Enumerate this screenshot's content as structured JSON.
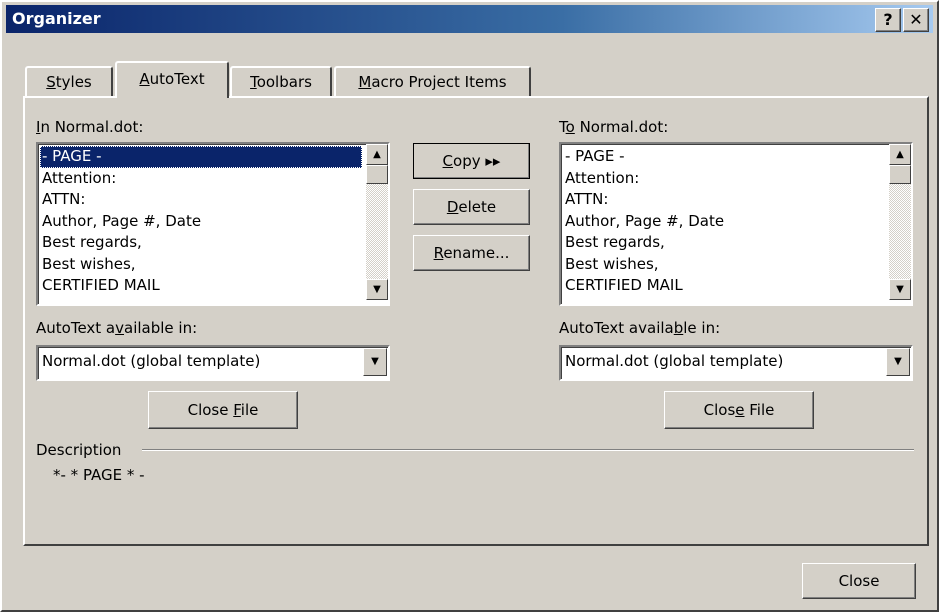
{
  "window": {
    "title": "Organizer",
    "help_label": "?",
    "close_label": "✕"
  },
  "tabs": [
    {
      "pre": "",
      "u": "S",
      "post": "tyles"
    },
    {
      "pre": "",
      "u": "A",
      "post": "utoText"
    },
    {
      "pre": "",
      "u": "T",
      "post": "oolbars"
    },
    {
      "pre": "",
      "u": "M",
      "post": "acro Project Items"
    }
  ],
  "left": {
    "in_label": {
      "pre": "",
      "u": "I",
      "post": "n Normal.dot:"
    },
    "items": [
      "- PAGE -",
      "Attention:",
      "ATTN:",
      "Author, Page #, Date",
      "Best regards,",
      "Best wishes,",
      "CERTIFIED MAIL"
    ],
    "avail_label": {
      "pre": "AutoText a",
      "u": "v",
      "post": "ailable in:"
    },
    "combo_value": "Normal.dot (global template)",
    "close_file": {
      "pre": "Close ",
      "u": "F",
      "post": "ile"
    }
  },
  "right": {
    "to_label": {
      "pre": "T",
      "u": "o",
      "post": " Normal.dot:"
    },
    "items": [
      "- PAGE -",
      "Attention:",
      "ATTN:",
      "Author, Page #, Date",
      "Best regards,",
      "Best wishes,",
      "CERTIFIED MAIL"
    ],
    "avail_label": {
      "pre": "AutoText availa",
      "u": "b",
      "post": "le in:"
    },
    "combo_value": "Normal.dot (global template)",
    "close_file": {
      "pre": "Clos",
      "u": "e",
      "post": " File"
    }
  },
  "middle": {
    "copy": {
      "pre": "",
      "u": "C",
      "post": "opy ▸▸"
    },
    "delete": {
      "pre": "",
      "u": "D",
      "post": "elete"
    },
    "rename": {
      "pre": "",
      "u": "R",
      "post": "ename..."
    }
  },
  "description": {
    "label": "Description",
    "text": "*- * PAGE * -"
  },
  "footer": {
    "close_label": "Close"
  }
}
